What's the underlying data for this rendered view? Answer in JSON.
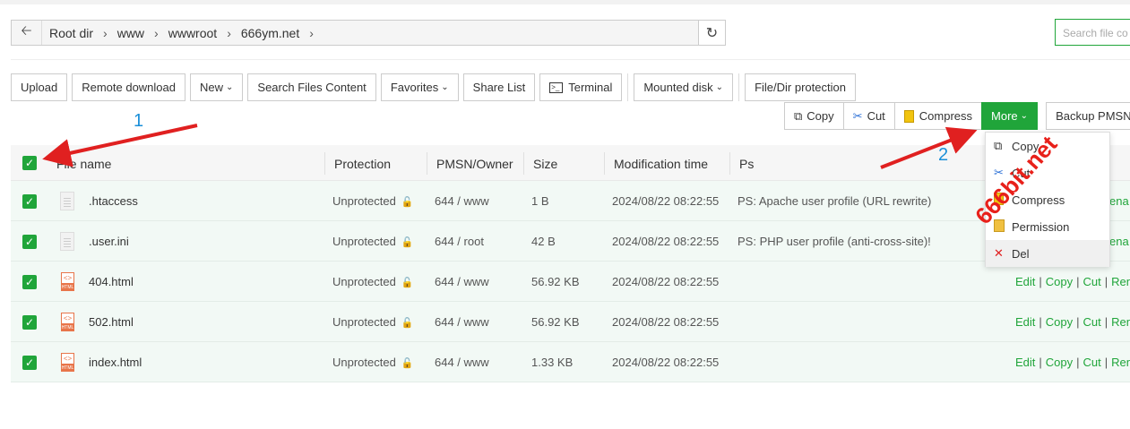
{
  "path": {
    "crumbs": [
      "Root dir",
      "www",
      "wwwroot",
      "666ym.net"
    ],
    "search_placeholder": "Search file co"
  },
  "toolbar": {
    "upload": "Upload",
    "remote_download": "Remote download",
    "new": "New",
    "search_files_content": "Search Files Content",
    "favorites": "Favorites",
    "share_list": "Share List",
    "terminal": "Terminal",
    "mounted_disk": "Mounted disk",
    "file_dir_protection": "File/Dir protection"
  },
  "batch": {
    "copy": "Copy",
    "cut": "Cut",
    "compress": "Compress",
    "more": "More",
    "backup": "Backup PMSN"
  },
  "dropdown": {
    "items": [
      "Copy",
      "Cut",
      "Compress",
      "Permission",
      "Del"
    ]
  },
  "table": {
    "headers": [
      "File name",
      "Protection",
      "PMSN/Owner",
      "Size",
      "Modification time",
      "Ps"
    ],
    "rows": [
      {
        "name": ".htaccess",
        "protection": "Unprotected",
        "pmsn": "644 / www",
        "size": "1 B",
        "mtime": "2024/08/22 08:22:55",
        "ps": "PS: Apache user profile (URL rewrite)",
        "ops_tail": "ena"
      },
      {
        "name": ".user.ini",
        "protection": "Unprotected",
        "pmsn": "644 / root",
        "size": "42 B",
        "mtime": "2024/08/22 08:22:55",
        "ps": "PS: PHP user profile (anti-cross-site)!",
        "ops_tail": "ena"
      },
      {
        "name": "404.html",
        "protection": "Unprotected",
        "pmsn": "644 / www",
        "size": "56.92 KB",
        "mtime": "2024/08/22 08:22:55",
        "ps": "",
        "ops": [
          "Edit",
          "Copy",
          "Cut",
          "Rena"
        ]
      },
      {
        "name": "502.html",
        "protection": "Unprotected",
        "pmsn": "644 / www",
        "size": "56.92 KB",
        "mtime": "2024/08/22 08:22:55",
        "ps": "",
        "ops": [
          "Edit",
          "Copy",
          "Cut",
          "Rena"
        ]
      },
      {
        "name": "index.html",
        "protection": "Unprotected",
        "pmsn": "644 / www",
        "size": "1.33 KB",
        "mtime": "2024/08/22 08:22:55",
        "ps": "",
        "ops": [
          "Edit",
          "Copy",
          "Cut",
          "Rena"
        ]
      }
    ]
  },
  "annotations": {
    "num1": "1",
    "num2": "2",
    "watermark": "666bit.net",
    "arrow_color": "#e02020",
    "num_color": "#1a8fd8"
  },
  "colors": {
    "accent": "#20a53a",
    "row_bg": "#f2f9f5"
  }
}
